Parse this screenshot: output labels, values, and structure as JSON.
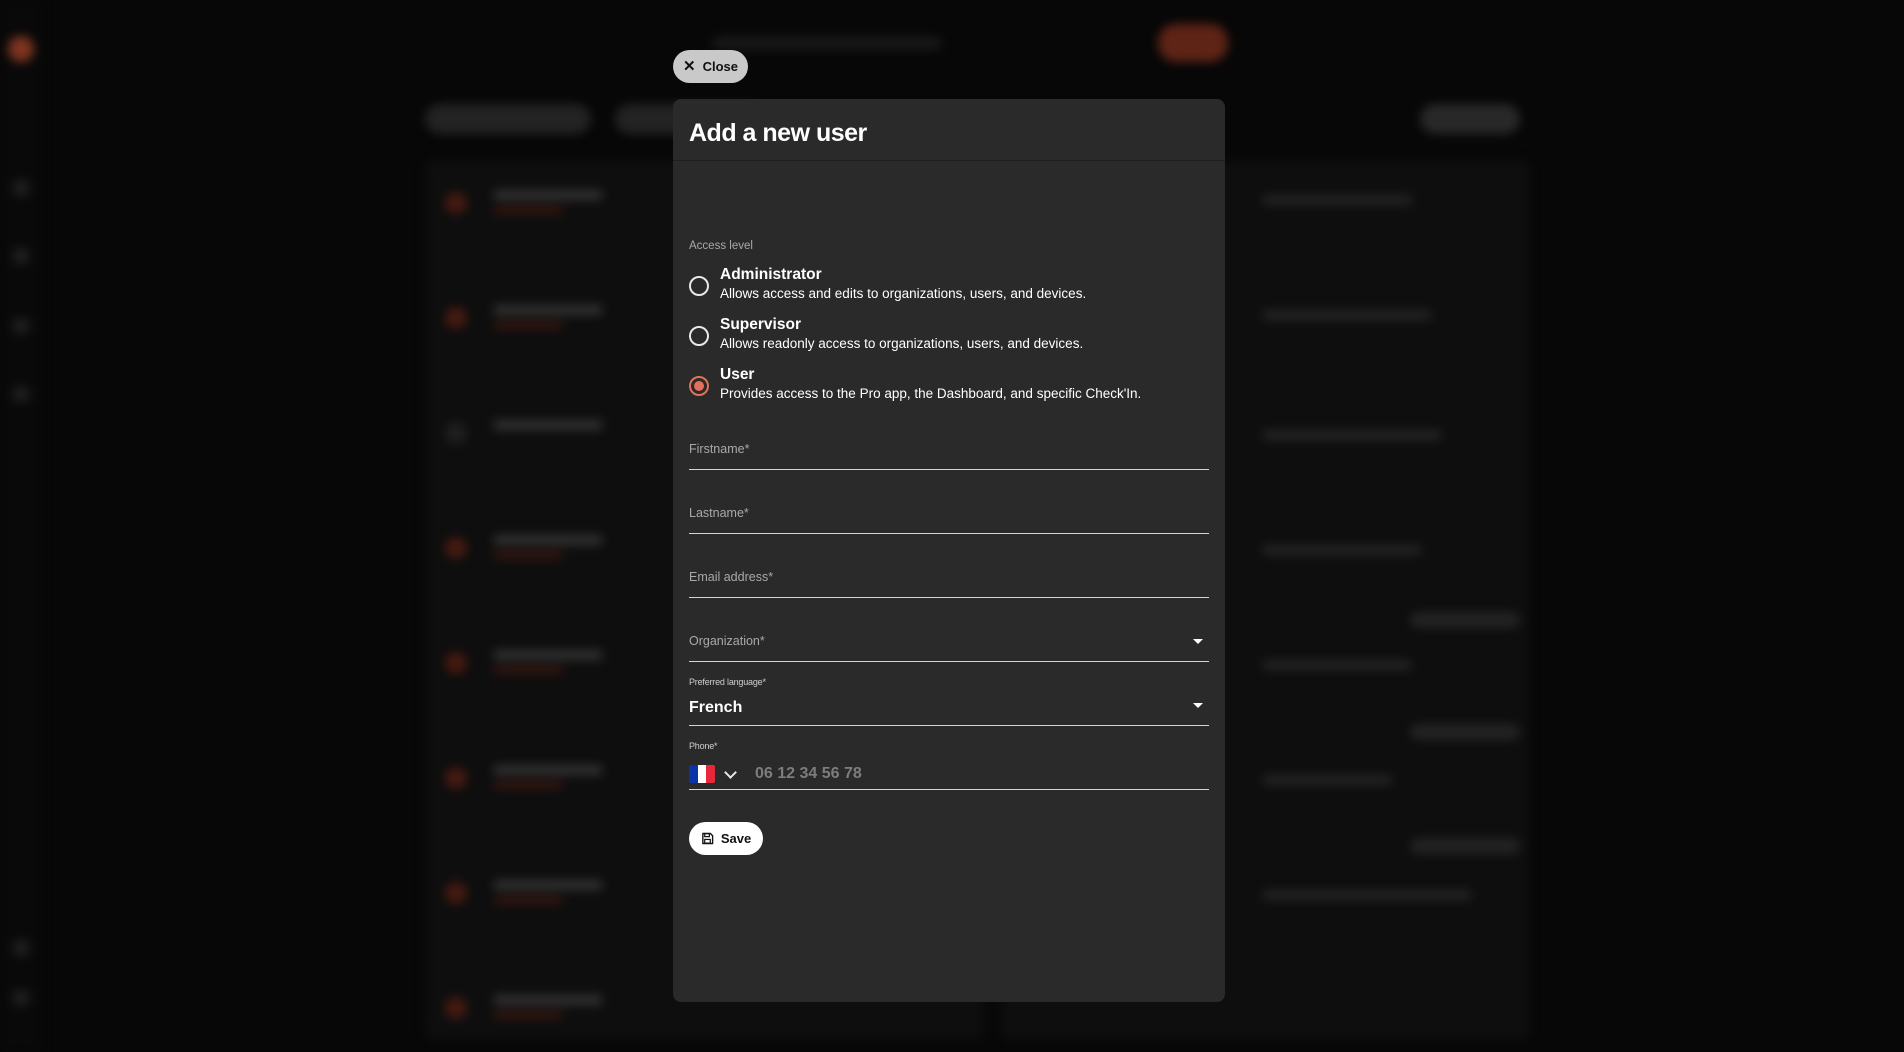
{
  "close_button": {
    "label": "Close",
    "icon": "close-icon"
  },
  "modal": {
    "title": "Add a new user",
    "access_level": {
      "label": "Access level",
      "selected": "User",
      "options": [
        {
          "title": "Administrator",
          "description": "Allows access and edits to organizations, users, and devices."
        },
        {
          "title": "Supervisor",
          "description": "Allows readonly access to organizations, users, and devices."
        },
        {
          "title": "User",
          "description": "Provides access to the Pro app, the Dashboard, and specific Check'In."
        }
      ]
    },
    "fields": {
      "firstname": {
        "label": "Firstname*",
        "value": ""
      },
      "lastname": {
        "label": "Lastname*",
        "value": ""
      },
      "email": {
        "label": "Email address*",
        "value": ""
      },
      "organization": {
        "label": "Organization*",
        "value": ""
      },
      "language": {
        "label": "Preferred language*",
        "value": "French"
      },
      "phone": {
        "label": "Phone*",
        "country": "FR",
        "placeholder": "06 12 34 56 78",
        "value": ""
      }
    },
    "save_button": {
      "label": "Save",
      "icon": "save-icon"
    }
  },
  "colors": {
    "accent": "#e2705a",
    "modal_bg": "#2a2a2a",
    "backdrop": "#070707",
    "flag_blue": "#0a35a8",
    "flag_white": "#ffffff",
    "flag_red": "#e8283a"
  }
}
